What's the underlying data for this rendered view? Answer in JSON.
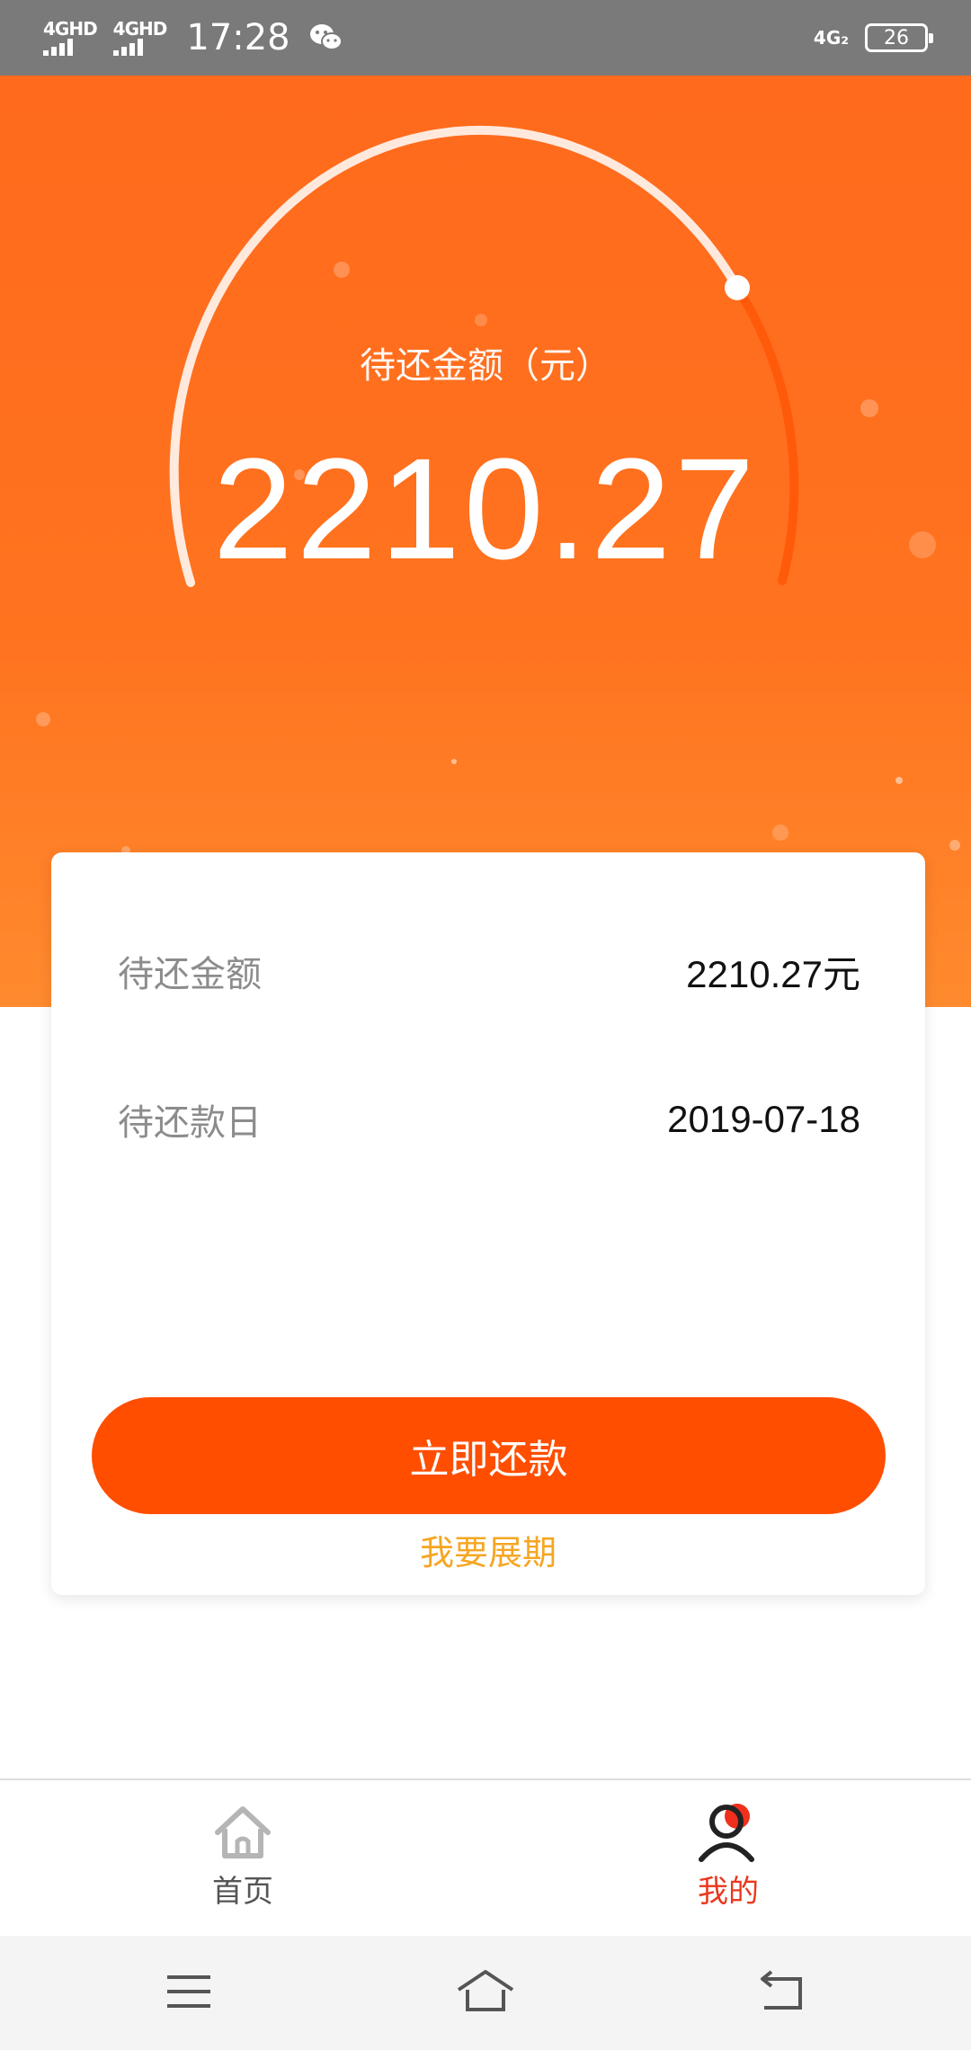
{
  "status_bar": {
    "signal_1": "4GHD",
    "signal_2": "4GHD",
    "time": "17:28",
    "network_2": "4G₂",
    "battery": "26",
    "icons": [
      "signal-icon",
      "wechat-icon",
      "battery-icon"
    ]
  },
  "hero": {
    "label": "待还金额（元）",
    "amount": "2210.27",
    "gauge_progress": 0.7,
    "colors": {
      "background": "#ff6a1c",
      "arc": "#ffffff",
      "arc_remaining": "#ff5a0a"
    }
  },
  "card": {
    "amount_label": "待还金额",
    "amount_value": "2210.27元",
    "date_label": "待还款日",
    "date_value": "2019-07-18",
    "pay_button": "立即还款",
    "extend_link": "我要展期",
    "colors": {
      "button": "#ff4e00",
      "link": "#f5a623"
    }
  },
  "tab_bar": {
    "tabs": [
      {
        "label": "首页",
        "icon": "home-icon",
        "active": false
      },
      {
        "label": "我的",
        "icon": "user-icon",
        "active": true
      }
    ],
    "colors": {
      "active": "#e8391e",
      "inactive": "#555555"
    }
  },
  "system_nav": {
    "buttons": [
      "menu-icon",
      "home-icon",
      "back-icon"
    ]
  }
}
